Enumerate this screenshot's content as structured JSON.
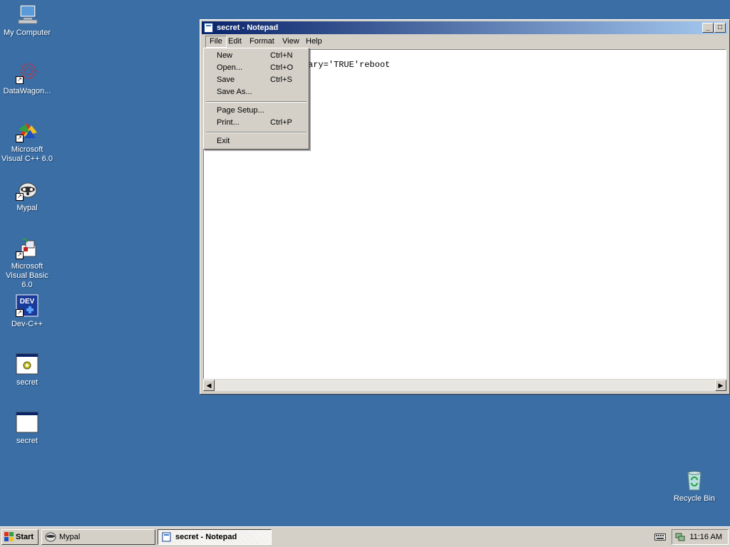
{
  "desktop": {
    "icons": [
      {
        "label": "My Computer"
      },
      {
        "label": "DataWagon..."
      },
      {
        "label": "Microsoft Visual C++ 6.0"
      },
      {
        "label": "Mypal"
      },
      {
        "label": "Microsoft Visual Basic 6.0"
      },
      {
        "label": "Dev-C++"
      },
      {
        "label": "secret"
      },
      {
        "label": "secret"
      },
      {
        "label": "Recycle Bin"
      }
    ]
  },
  "window": {
    "title": "secret - Notepad",
    "menus": [
      "File",
      "Edit",
      "Format",
      "View",
      "Help"
    ],
    "content": "ary='TRUE'reboot"
  },
  "file_menu": {
    "items": [
      {
        "label": "New",
        "shortcut": "Ctrl+N"
      },
      {
        "label": "Open...",
        "shortcut": "Ctrl+O"
      },
      {
        "label": "Save",
        "shortcut": "Ctrl+S"
      },
      {
        "label": "Save As...",
        "shortcut": ""
      },
      {
        "label": "Page Setup...",
        "shortcut": ""
      },
      {
        "label": "Print...",
        "shortcut": "Ctrl+P"
      },
      {
        "label": "Exit",
        "shortcut": ""
      }
    ]
  },
  "taskbar": {
    "start_label": "Start",
    "tasks": [
      {
        "label": "Mypal"
      },
      {
        "label": "secret - Notepad"
      }
    ],
    "clock": "11:16 AM"
  }
}
